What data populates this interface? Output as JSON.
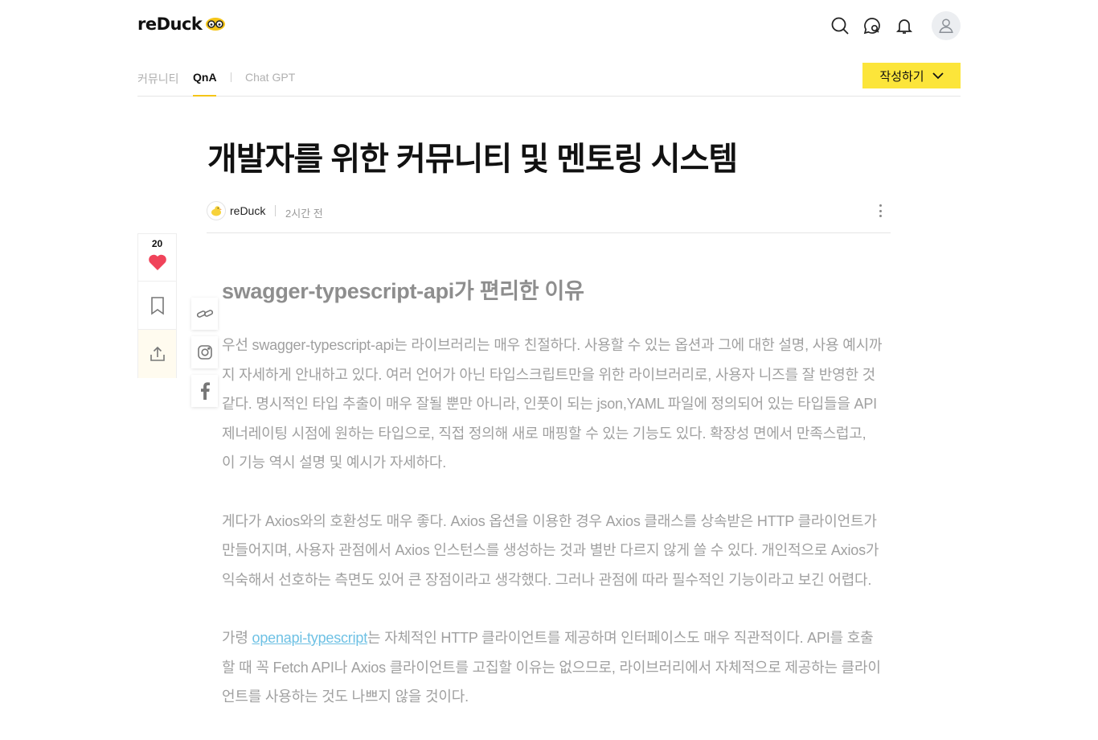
{
  "header": {
    "logo_text": "reDuck",
    "icons": [
      "search-icon",
      "chat-search-icon",
      "bell-icon",
      "user-avatar-icon"
    ]
  },
  "tabs": {
    "items": [
      {
        "label": "커뮤니티"
      },
      {
        "label": "QnA"
      },
      {
        "label": "Chat GPT"
      }
    ],
    "active": "QnA",
    "write_button_label": "작성하기"
  },
  "post": {
    "title": "개발자를 위한 커뮤니티 및 멘토링 시스템",
    "author": "reDuck",
    "time": "2시간 전",
    "like_count": "20"
  },
  "article": {
    "heading": "swagger-typescript-api가 편리한 이유",
    "paragraphs": [
      "우선 swagger-typescript-api는 라이브러리는 매우 친절하다. 사용할 수 있는 옵션과 그에 대한 설명, 사용 예시까지 자세하게 안내하고 있다. 여러 언어가 아닌 타입스크립트만을 위한 라이브러리로, 사용자 니즈를 잘 반영한 것 같다. 명시적인 타입 추출이 매우 잘될 뿐만 아니라, 인풋이 되는 json,YAML 파일에 정의되어 있는 타입들을 API 제너레이팅 시점에 원하는 타입으로, 직접 정의해 새로 매핑할 수 있는 기능도 있다. 확장성 면에서 만족스럽고, 이 기능 역시 설명 및 예시가 자세하다.",
      "게다가 Axios와의 호환성도 매우 좋다. Axios 옵션을 이용한 경우 Axios 클래스를 상속받은 HTTP 클라이언트가 만들어지며, 사용자 관점에서 Axios 인스턴스를 생성하는 것과 별반 다르지 않게 쓸 수 있다. 개인적으로 Axios가 익숙해서 선호하는 측면도 있어 큰 장점이라고 생각했다. 그러나 관점에 따라 필수적인 기능이라고 보긴 어렵다."
    ],
    "p3_before": "가령 ",
    "p3_link": "openapi-typescript",
    "p3_after": "는 자체적인 HTTP 클라이언트를 제공하며 인터페이스도 매우 직관적이다. API를 호출할 때 꼭 Fetch API나 Axios 클라이언트를 고집할 이유는 없으므로, 라이브러리에서 자체적으로 제공하는 클라이언트를 사용하는 것도 나쁘지 않을 것이다."
  },
  "colors": {
    "accent_yellow": "#fce53a",
    "like_red": "#f0435a",
    "link_blue": "#6ec1e4"
  }
}
